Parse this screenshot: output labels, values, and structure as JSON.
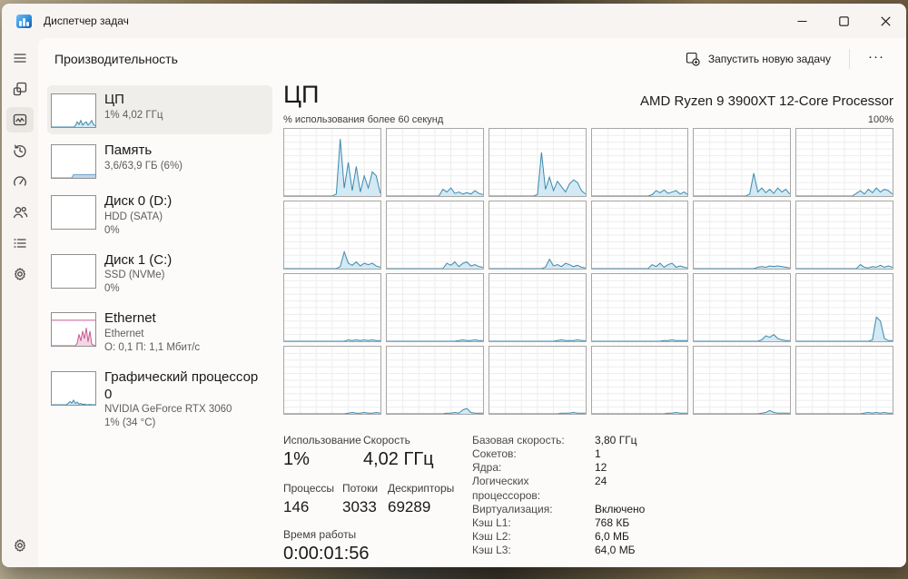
{
  "colors": {
    "accent": "#0067c0"
  },
  "window": {
    "title": "Диспетчер задач",
    "controls": [
      "minimize",
      "maximize",
      "close"
    ]
  },
  "page": {
    "title": "Производительность",
    "run_new_task": "Запустить новую задачу",
    "more_label": "···"
  },
  "nav": {
    "items": [
      {
        "id": "menu",
        "icon": "hamburger-icon",
        "selected": false
      },
      {
        "id": "processes",
        "icon": "processes-icon",
        "selected": false
      },
      {
        "id": "performance",
        "icon": "performance-icon",
        "selected": true
      },
      {
        "id": "app-history",
        "icon": "history-icon",
        "selected": false
      },
      {
        "id": "startup-apps",
        "icon": "startup-icon",
        "selected": false
      },
      {
        "id": "users",
        "icon": "users-icon",
        "selected": false
      },
      {
        "id": "details",
        "icon": "details-icon",
        "selected": false
      },
      {
        "id": "services",
        "icon": "services-icon",
        "selected": false
      }
    ],
    "bottom": {
      "id": "settings",
      "icon": "gear-icon"
    }
  },
  "sidebar": {
    "items": [
      {
        "id": "cpu",
        "title": "ЦП",
        "lines": [
          "1% 4,02 ГГц"
        ],
        "selected": true,
        "chart": "cpu"
      },
      {
        "id": "memory",
        "title": "Память",
        "lines": [
          "3,6/63,9 ГБ (6%)"
        ],
        "selected": false,
        "chart": "memory"
      },
      {
        "id": "disk0",
        "title": "Диск 0 (D:)",
        "lines": [
          "HDD (SATA)",
          "0%"
        ],
        "selected": false,
        "chart": "empty"
      },
      {
        "id": "disk1",
        "title": "Диск 1 (C:)",
        "lines": [
          "SSD (NVMe)",
          "0%"
        ],
        "selected": false,
        "chart": "empty"
      },
      {
        "id": "ethernet",
        "title": "Ethernet",
        "lines": [
          "Ethernet",
          "О: 0,1 П: 1,1 Мбит/с"
        ],
        "selected": false,
        "chart": "ethernet"
      },
      {
        "id": "gpu",
        "title": "Графический процессор 0",
        "lines": [
          "NVIDIA GeForce RTX 3060",
          "1% (34 °C)"
        ],
        "selected": false,
        "chart": "gpu"
      }
    ]
  },
  "cpu": {
    "title": "ЦП",
    "processor": "AMD Ryzen 9 3900XT 12-Core Processor",
    "caption_left": "% использования более 60 секунд",
    "caption_right": "100%",
    "stats": {
      "usage_label": "Использование",
      "usage": "1%",
      "speed_label": "Скорость",
      "speed": "4,02 ГГц",
      "processes_label": "Процессы",
      "processes": "146",
      "threads_label": "Потоки",
      "threads": "3033",
      "handles_label": "Дескрипторы",
      "handles": "69289",
      "uptime_label": "Время работы",
      "uptime": "0:00:01:56"
    },
    "details": [
      {
        "label": "Базовая скорость:",
        "value": "3,80 ГГц"
      },
      {
        "label": "Сокетов:",
        "value": "1"
      },
      {
        "label": "Ядра:",
        "value": "12"
      },
      {
        "label": "Логических процессоров:",
        "value": "24"
      },
      {
        "label": "Виртуализация:",
        "value": "Включено"
      },
      {
        "label": "Кэш L1:",
        "value": "768 КБ"
      },
      {
        "label": "Кэш L2:",
        "value": "6,0 МБ"
      },
      {
        "label": "Кэш L3:",
        "value": "64,0 МБ"
      }
    ]
  },
  "chart_data": {
    "type": "line",
    "title": "Per-logical-processor CPU usage, 60 second window",
    "ylim": [
      0,
      100
    ],
    "colors": {
      "cpu_stroke": "#3c89ad",
      "cpu_fill": "#d3e9f3",
      "mem_stroke": "#6ba3c8",
      "mem_fill": "#bcd8ea",
      "eth_stroke": "#c75d93",
      "eth_fill": "#f3d6e4",
      "grid": "#ededed",
      "border": "#a7a7a7"
    },
    "cores": [
      [
        0,
        0,
        0,
        0,
        0,
        0,
        0,
        0,
        0,
        0,
        0,
        0,
        0,
        3,
        85,
        12,
        50,
        8,
        44,
        6,
        30,
        12,
        36,
        30,
        4
      ],
      [
        0,
        0,
        0,
        0,
        0,
        0,
        0,
        0,
        0,
        0,
        0,
        0,
        0,
        0,
        10,
        6,
        12,
        4,
        6,
        3,
        5,
        3,
        8,
        4,
        2
      ],
      [
        0,
        0,
        0,
        0,
        0,
        0,
        0,
        0,
        0,
        0,
        0,
        0,
        2,
        65,
        10,
        28,
        8,
        22,
        14,
        6,
        18,
        24,
        20,
        8,
        3
      ],
      [
        0,
        0,
        0,
        0,
        0,
        0,
        0,
        0,
        0,
        0,
        0,
        0,
        0,
        0,
        0,
        2,
        8,
        5,
        9,
        4,
        6,
        8,
        3,
        6,
        2
      ],
      [
        0,
        0,
        0,
        0,
        0,
        0,
        0,
        0,
        0,
        0,
        0,
        0,
        0,
        0,
        3,
        34,
        6,
        12,
        5,
        10,
        4,
        12,
        6,
        10,
        3
      ],
      [
        0,
        0,
        0,
        0,
        0,
        0,
        0,
        0,
        0,
        0,
        0,
        0,
        0,
        0,
        0,
        4,
        8,
        3,
        10,
        5,
        12,
        6,
        10,
        8,
        3
      ],
      [
        0,
        0,
        0,
        0,
        0,
        0,
        0,
        0,
        0,
        0,
        0,
        0,
        0,
        0,
        3,
        25,
        8,
        5,
        10,
        4,
        8,
        6,
        8,
        4,
        2
      ],
      [
        0,
        0,
        0,
        0,
        0,
        0,
        0,
        0,
        0,
        0,
        0,
        0,
        0,
        0,
        0,
        8,
        5,
        10,
        3,
        8,
        10,
        4,
        6,
        3,
        2
      ],
      [
        0,
        0,
        0,
        0,
        0,
        0,
        0,
        0,
        0,
        0,
        0,
        0,
        0,
        0,
        2,
        14,
        4,
        6,
        3,
        8,
        6,
        3,
        5,
        2,
        1
      ],
      [
        0,
        0,
        0,
        0,
        0,
        0,
        0,
        0,
        0,
        0,
        0,
        0,
        0,
        0,
        0,
        6,
        3,
        8,
        2,
        6,
        8,
        2,
        4,
        2,
        1
      ],
      [
        0,
        0,
        0,
        0,
        0,
        0,
        0,
        0,
        0,
        0,
        0,
        0,
        0,
        0,
        0,
        0,
        2,
        3,
        2,
        4,
        3,
        4,
        3,
        2,
        1
      ],
      [
        0,
        0,
        0,
        0,
        0,
        0,
        0,
        0,
        0,
        0,
        0,
        0,
        0,
        0,
        0,
        0,
        6,
        2,
        1,
        3,
        2,
        5,
        2,
        4,
        2
      ],
      [
        0,
        0,
        0,
        0,
        0,
        0,
        0,
        0,
        0,
        0,
        0,
        0,
        0,
        0,
        0,
        0,
        2,
        1,
        2,
        1,
        2,
        1,
        2,
        1,
        1
      ],
      [
        0,
        0,
        0,
        0,
        0,
        0,
        0,
        0,
        0,
        0,
        0,
        0,
        0,
        0,
        0,
        0,
        0,
        0,
        1,
        2,
        1,
        1,
        2,
        1,
        1
      ],
      [
        0,
        0,
        0,
        0,
        0,
        0,
        0,
        0,
        0,
        0,
        0,
        0,
        0,
        0,
        0,
        0,
        0,
        1,
        2,
        1,
        1,
        1,
        2,
        1,
        1
      ],
      [
        0,
        0,
        0,
        0,
        0,
        0,
        0,
        0,
        0,
        0,
        0,
        0,
        0,
        0,
        0,
        0,
        0,
        0,
        1,
        1,
        2,
        1,
        1,
        1,
        1
      ],
      [
        0,
        0,
        0,
        0,
        0,
        0,
        0,
        0,
        0,
        0,
        0,
        0,
        0,
        0,
        0,
        0,
        0,
        2,
        8,
        6,
        10,
        4,
        2,
        1,
        1
      ],
      [
        0,
        0,
        0,
        0,
        0,
        0,
        0,
        0,
        0,
        0,
        0,
        0,
        0,
        0,
        0,
        0,
        0,
        0,
        0,
        2,
        36,
        30,
        4,
        1,
        1
      ],
      [
        0,
        0,
        0,
        0,
        0,
        0,
        0,
        0,
        0,
        0,
        0,
        0,
        0,
        0,
        0,
        0,
        1,
        2,
        1,
        1,
        2,
        1,
        1,
        2,
        1
      ],
      [
        0,
        0,
        0,
        0,
        0,
        0,
        0,
        0,
        0,
        0,
        0,
        0,
        0,
        0,
        0,
        1,
        1,
        2,
        1,
        6,
        8,
        2,
        1,
        1,
        1
      ],
      [
        0,
        0,
        0,
        0,
        0,
        0,
        0,
        0,
        0,
        0,
        0,
        0,
        0,
        0,
        0,
        0,
        0,
        0,
        1,
        1,
        1,
        2,
        1,
        1,
        1
      ],
      [
        0,
        0,
        0,
        0,
        0,
        0,
        0,
        0,
        0,
        0,
        0,
        0,
        0,
        0,
        0,
        0,
        0,
        0,
        0,
        1,
        1,
        2,
        1,
        1,
        1
      ],
      [
        0,
        0,
        0,
        0,
        0,
        0,
        0,
        0,
        0,
        0,
        0,
        0,
        0,
        0,
        0,
        0,
        0,
        1,
        2,
        5,
        2,
        1,
        1,
        1,
        1
      ],
      [
        0,
        0,
        0,
        0,
        0,
        0,
        0,
        0,
        0,
        0,
        0,
        0,
        0,
        0,
        0,
        0,
        0,
        1,
        2,
        1,
        2,
        1,
        2,
        1,
        1
      ]
    ],
    "mini": {
      "cpu": [
        0,
        0,
        0,
        0,
        0,
        0,
        0,
        0,
        0,
        0,
        0,
        0,
        0,
        4,
        16,
        8,
        20,
        6,
        12,
        16,
        6,
        12,
        20,
        8,
        4
      ],
      "memory": [
        0,
        0,
        0,
        0,
        0,
        0,
        0,
        0,
        0,
        0,
        0,
        0,
        10,
        10,
        10,
        10,
        10,
        10,
        10,
        10,
        10,
        10,
        10,
        10,
        10
      ],
      "empty": [
        0,
        0
      ],
      "ethernet": [
        0,
        0,
        0,
        0,
        0,
        0,
        0,
        0,
        0,
        0,
        0,
        0,
        0,
        0,
        8,
        35,
        15,
        45,
        22,
        55,
        12,
        45,
        5,
        2,
        0
      ],
      "gpu": [
        0,
        0,
        0,
        0,
        0,
        0,
        0,
        0,
        0,
        4,
        10,
        5,
        14,
        4,
        8,
        2,
        4,
        1,
        2,
        0,
        0,
        1,
        0,
        0,
        0
      ],
      "ethernet_topline": 78
    }
  }
}
